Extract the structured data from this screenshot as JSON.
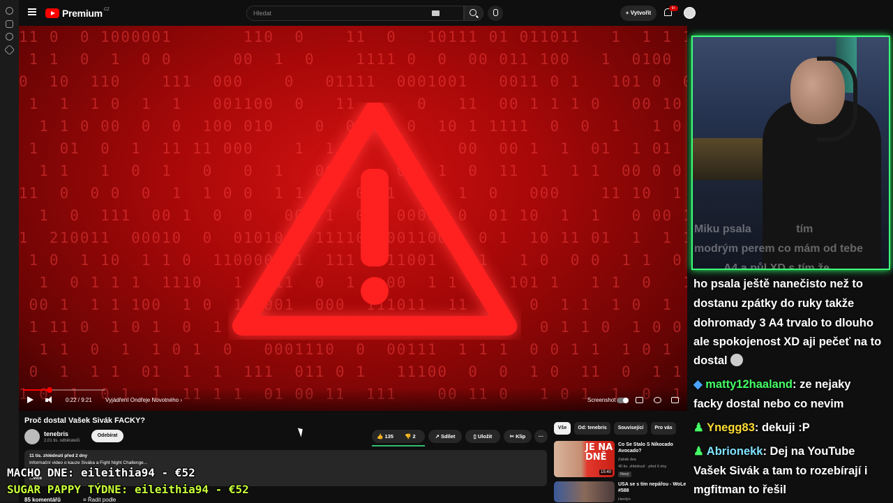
{
  "youtube": {
    "logo_text": "Premium",
    "logo_region": "CZ",
    "search_placeholder": "Hledat",
    "create_label": "Vytvořit",
    "notif_count": "9+",
    "player": {
      "progress_fraction": 0.04,
      "time": "0:22 / 9:21",
      "chapter": "Vyjádření Ondřeje Novotného",
      "screenshot_label": "Screenshot"
    },
    "video_title": "Proč dostal Vašek Sivák FACKY?",
    "channel_name": "tenebris",
    "channel_subs": "2,01 tis. odběratelů",
    "subscribe_label": "Odebírat",
    "likes": "135",
    "dislikes": "2",
    "share_label": "Sdílet",
    "save_label": "Uložit",
    "clip_label": "Klip",
    "more_label": "···",
    "description": {
      "stats": "11 tis. zhlédnutí  před 2 dny",
      "line1": "Informační video o kauze Siváka a Fight Night Challenge...",
      "more": "...více"
    },
    "comments_count": "85 komentářů",
    "sort_label": "Řadit podle",
    "chips": [
      "Vše",
      "Od: tenebris",
      "Související",
      "Pro vás"
    ],
    "related": [
      {
        "thumb_text_1": "JE NA",
        "thumb_text_2": "DNĚ",
        "duration": "15:40",
        "title": "Co Se Stalo S Nikocado Avocado?",
        "channel": "Zabák dva",
        "meta": "40 tis. zhlédnutí · před 6 dny",
        "badge": "Nový"
      },
      {
        "title": "USA se s tím nepářou - WoLe #588",
        "channel": "Herdyn"
      }
    ]
  },
  "stream": {
    "webcam_caption_1": "Miku psala",
    "webcam_caption_2": "tím",
    "webcam_caption_3": "modrým perem co mám od tebe",
    "webcam_caption_4": "A4 a půl XD s tím že",
    "chat": [
      {
        "text": "ho psala ještě nanečisto než to"
      },
      {
        "text": "dostanu zpátky do ruky takže"
      },
      {
        "text": "dohromady 3 A4 trvalo to dlouho"
      },
      {
        "text": "ale spokojenost XD aji pečeť na to"
      },
      {
        "text": "dostal"
      },
      {
        "user": "matty12haaland",
        "text": ": ze nejaky"
      },
      {
        "text": "facky dostal nebo co nevim"
      },
      {
        "user": "Ynegg83",
        "text": ": dekuji :P"
      },
      {
        "user": "Abrionekk",
        "text": ": Dej na YouTube"
      },
      {
        "text": "Vašek Sivák a tam to rozebírají i"
      },
      {
        "text": "mgfitman to řešil"
      }
    ],
    "overlay_1": "MACHO DNE: eileithia94 - €52",
    "overlay_2": "SUGAR PAPPY TÝDNE: eileithia94 - €52"
  },
  "colors": {
    "accent_red": "#ff0000",
    "chat_user_green": "#44ff66",
    "chat_user_yellow": "#ffdd33",
    "chat_user_cyan": "#7fe3ff",
    "cam_border": "#3cff7a"
  }
}
